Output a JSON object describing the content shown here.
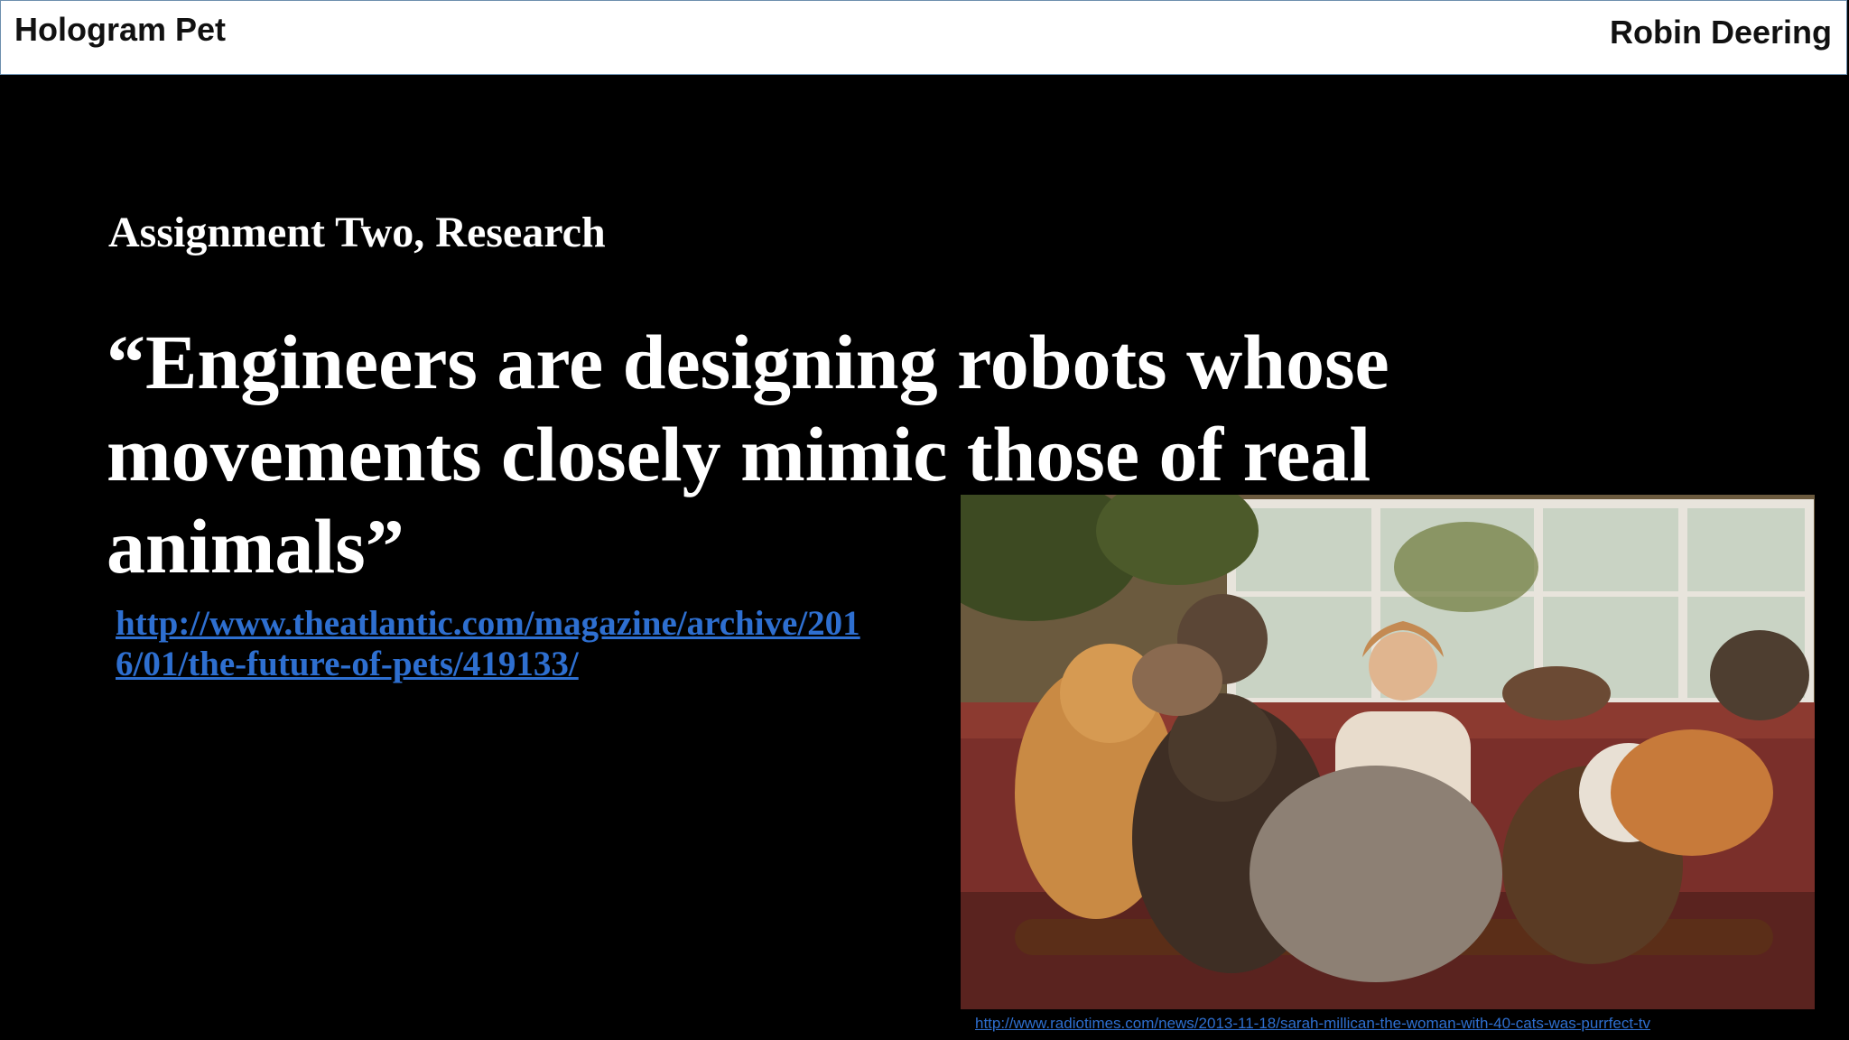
{
  "header": {
    "title": "Hologram Pet",
    "author": "Robin Deering"
  },
  "slide": {
    "subtitle": "Assignment Two, Research",
    "quote": "“Engineers are designing robots whose movements closely mimic those of real animals”",
    "source_link": "http://www.theatlantic.com/magazine/archive/2016/01/the-future-of-pets/419133/",
    "photo_credit": "http://www.radiotimes.com/news/2013-11-18/sarah-millican-the-woman-with-40-cats-was-purrfect-tv"
  },
  "colors": {
    "background": "#000000",
    "link": "#2e6fd0",
    "header_bg": "#ffffff"
  }
}
